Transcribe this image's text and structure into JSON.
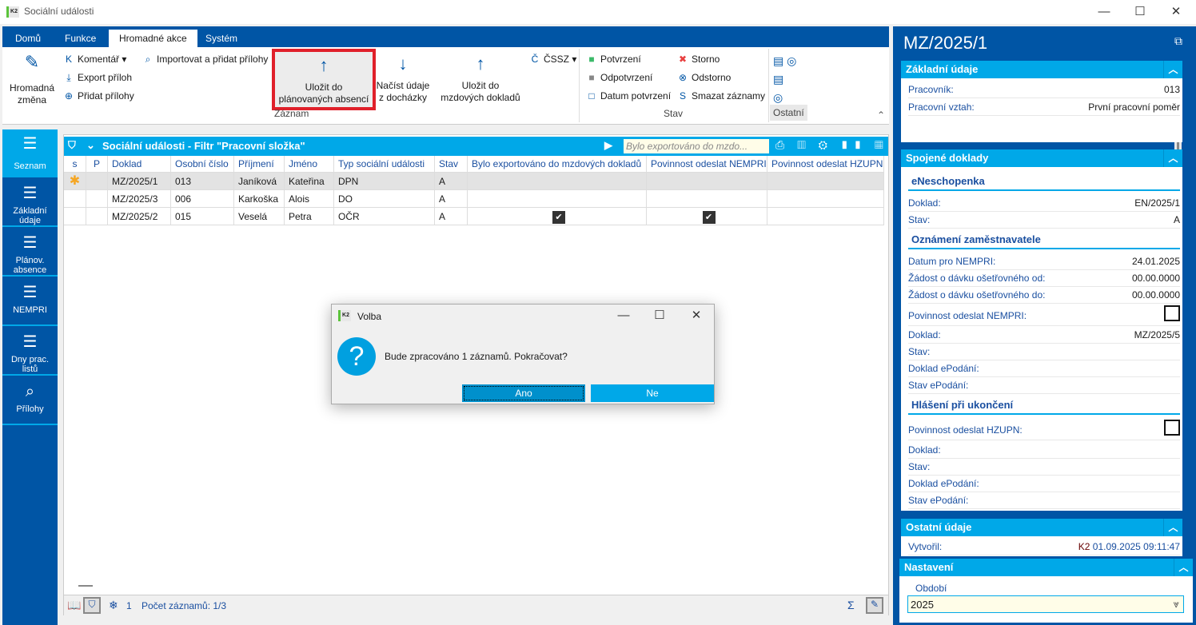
{
  "window": {
    "title": "Sociální události",
    "logo": "K2"
  },
  "tabs": [
    "Domů",
    "Funkce",
    "Hromadné akce",
    "Systém"
  ],
  "ribbon": {
    "hromadna": [
      "Hromadná",
      "změna"
    ],
    "komentar": "Komentář",
    "export": "Export příloh",
    "pridat": "Přidat přílohy",
    "importovat": "Importovat a přidat přílohy",
    "ulozit_abs": [
      "Uložit do",
      "plánovaných absencí"
    ],
    "nacist": [
      "Načíst údaje",
      "z docházky"
    ],
    "ulozit_mzd": [
      "Uložit do",
      "mzdových dokladů"
    ],
    "cssz": "ČSSZ",
    "group_zaznam": "Záznam",
    "potvrzeni": "Potvrzení",
    "odpotvrzeni": "Odpotvrzení",
    "datum_potvrzeni": "Datum potvrzení",
    "storno": "Storno",
    "odstorno": "Odstorno",
    "smazat": "Smazat záznamy",
    "group_stav": "Stav",
    "group_ostatni": "Ostatní"
  },
  "sidebar": [
    {
      "label": "Seznam"
    },
    {
      "label": "Základní údaje"
    },
    {
      "label": "Plánov. absence"
    },
    {
      "label": "NEMPRI"
    },
    {
      "label": "Dny prac. listů"
    },
    {
      "label": "Přílohy"
    }
  ],
  "grid": {
    "title": "Sociální události - Filtr \"Pracovní složka\"",
    "search_placeholder": "Bylo exportováno do mzdo...",
    "columns": [
      "s",
      "P",
      "Doklad",
      "Osobní číslo",
      "Příjmení",
      "Jméno",
      "Typ sociální události",
      "Stav",
      "Bylo exportováno do mzdových dokladů",
      "Povinnost odeslat NEMPRI",
      "Povinnost odeslat HZUPN"
    ],
    "rows": [
      {
        "doklad": "MZ/2025/1",
        "os": "013",
        "prijmeni": "Janíková",
        "jmeno": "Kateřina",
        "typ": "DPN",
        "stav": "A",
        "exp": false,
        "nempri": false,
        "hzupn": false
      },
      {
        "doklad": "MZ/2025/3",
        "os": "006",
        "prijmeni": "Karkoška",
        "jmeno": "Alois",
        "typ": "DO",
        "stav": "A",
        "exp": false,
        "nempri": false,
        "hzupn": false
      },
      {
        "doklad": "MZ/2025/2",
        "os": "015",
        "prijmeni": "Veselá",
        "jmeno": "Petra",
        "typ": "OČR",
        "stav": "A",
        "exp": true,
        "nempri": true,
        "hzupn": false
      }
    ],
    "status_count": "1",
    "status_records": "Počet záznamů: 1/3"
  },
  "right": {
    "title": "MZ/2025/1",
    "zakladni": {
      "header": "Základní údaje",
      "pracovnik_l": "Pracovník:",
      "pracovnik_v": "013",
      "vztah_l": "Pracovní vztah:",
      "vztah_v": "První pracovní poměr"
    },
    "spojene": {
      "header": "Spojené doklady",
      "eneschopenka": "eNeschopenka",
      "doklad_l": "Doklad:",
      "doklad_v": "EN/2025/1",
      "stav_l": "Stav:",
      "stav_v": "A",
      "oznameni": "Oznámení zaměstnavatele",
      "datum_l": "Datum pro NEMPRI:",
      "datum_v": "24.01.2025",
      "od_l": "Žádost o dávku ošetřovného od:",
      "od_v": "00.00.0000",
      "do_l": "Žádost o dávku ošetřovného do:",
      "do_v": "00.00.0000",
      "pov_nempri": "Povinnost odeslat NEMPRI:",
      "doklad2_v": "MZ/2025/5",
      "doklad_epod": "Doklad ePodání:",
      "stav_epod": "Stav ePodání:",
      "hlaseni": "Hlášení při ukončení",
      "pov_hzupn": "Povinnost odeslat HZUPN:"
    },
    "ostatni": {
      "header": "Ostatní údaje",
      "vytvoril_l": "Vytvořil:",
      "vytvoril_user": "K2",
      "vytvoril_v": "01.09.2025 09:11:47"
    },
    "nastaveni": {
      "header": "Nastavení",
      "obdobi_l": "Období",
      "obdobi_v": "2025"
    }
  },
  "dialog": {
    "title": "Volba",
    "message": "Bude zpracováno 1 záznamů. Pokračovat?",
    "yes": "Ano",
    "no": "Ne"
  }
}
